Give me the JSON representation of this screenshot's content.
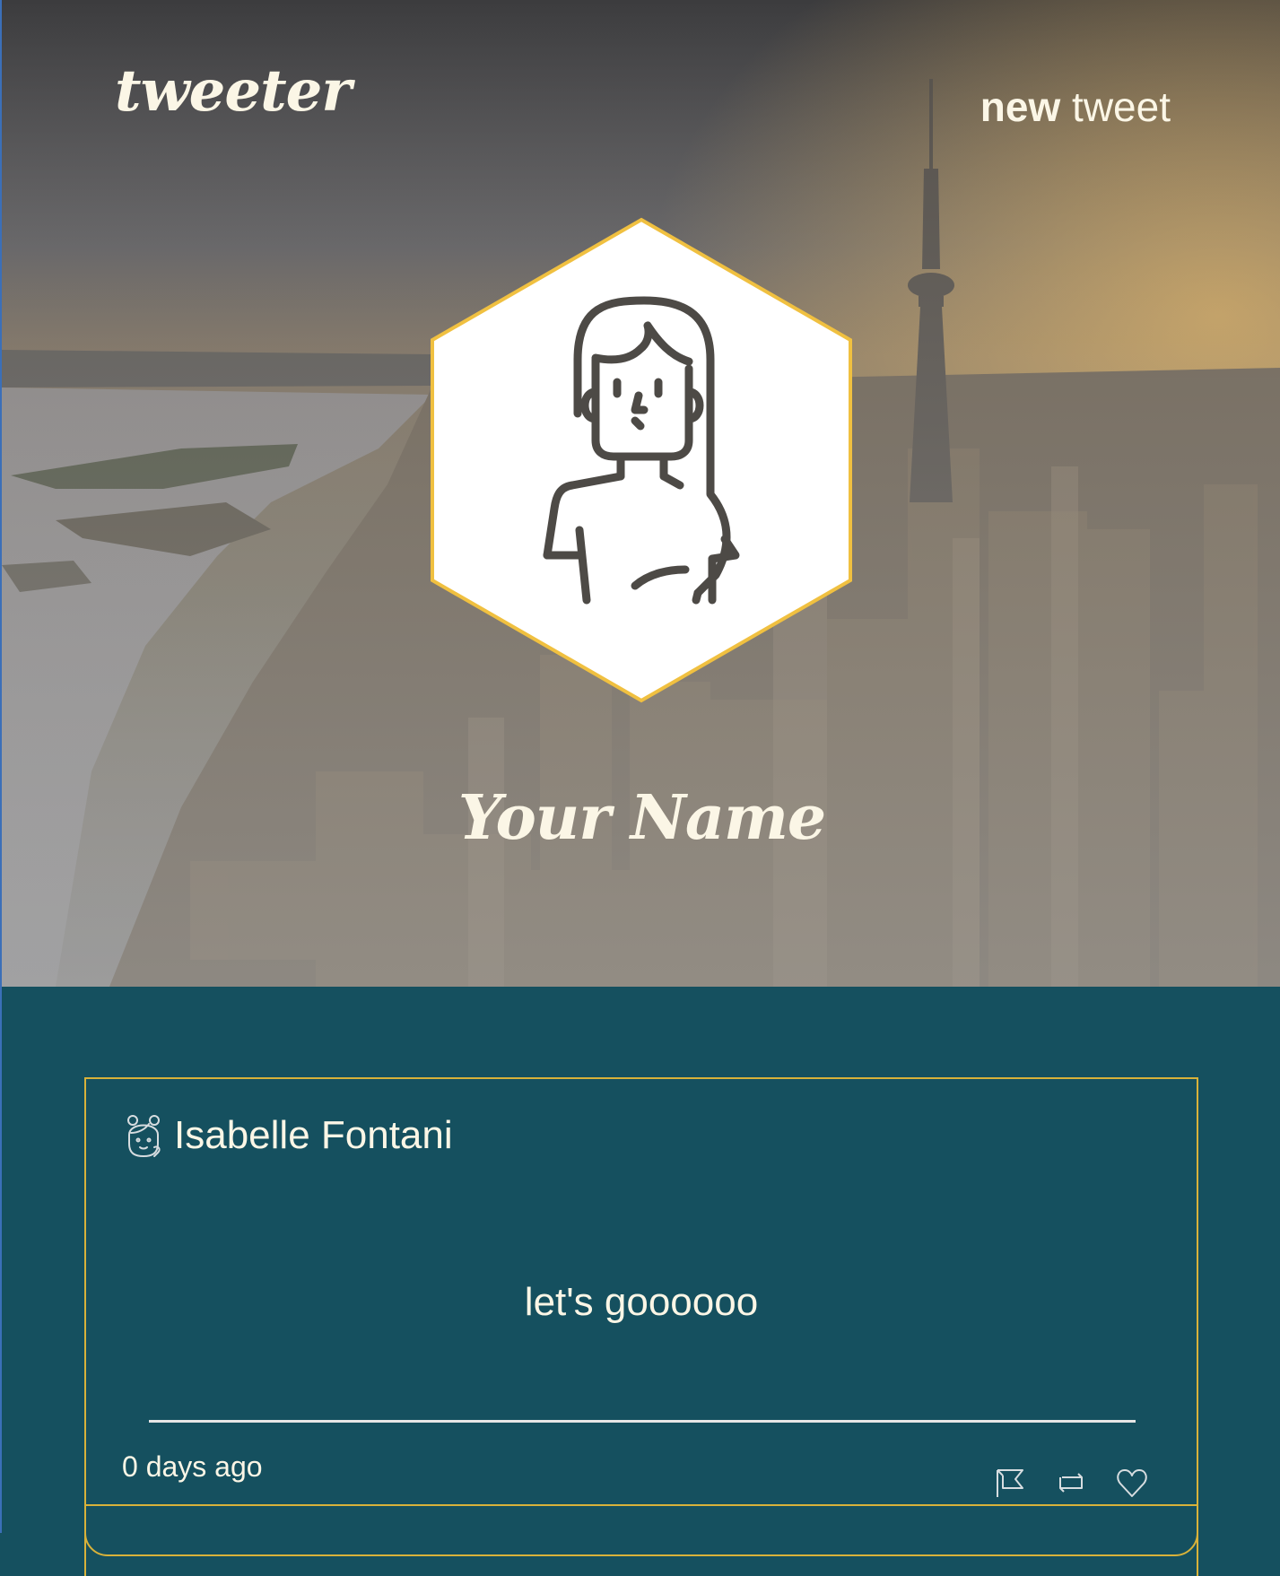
{
  "header": {
    "brand": "tweeter",
    "new_tweet_bold": "new",
    "new_tweet_rest": " tweet"
  },
  "profile": {
    "avatar_icon": "woman-avatar-icon",
    "display_name": "Your Name"
  },
  "feed": {
    "tweets": [
      {
        "user_icon": "girl-avatar-icon",
        "user_name": "Isabelle Fontani",
        "text": "let's goooooo",
        "time": "0 days ago",
        "actions": [
          "flag-icon",
          "retweet-icon",
          "heart-icon"
        ]
      }
    ]
  },
  "colors": {
    "feed_bg": "#15505f",
    "accent_gold": "#f0c040",
    "card_border": "#d8b23a",
    "text_cream": "#fbf6e6"
  }
}
